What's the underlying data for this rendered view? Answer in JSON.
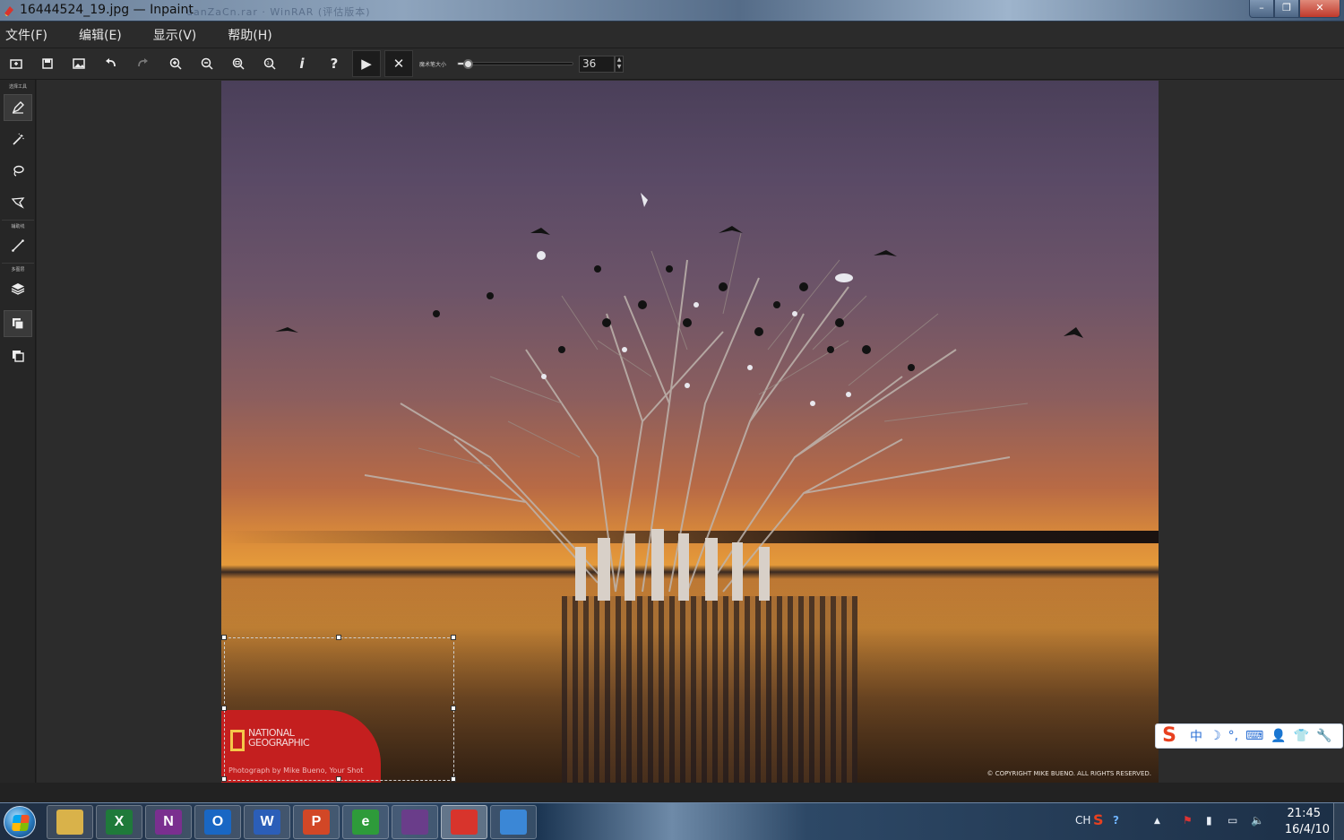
{
  "window": {
    "title": "16444524_19.jpg — Inpaint",
    "background_ghost_text": "uanZaCn.rar · WinRAR (评估版本)"
  },
  "window_controls": {
    "minimize": "–",
    "maximize": "❐",
    "close": "✕"
  },
  "menu": [
    "文件(F)",
    "编辑(E)",
    "显示(V)",
    "帮助(H)"
  ],
  "toolbar": {
    "buttons": [
      {
        "name": "open-icon"
      },
      {
        "name": "save-icon"
      },
      {
        "name": "image-icon"
      },
      {
        "name": "undo-icon"
      },
      {
        "name": "redo-icon"
      },
      {
        "name": "zoom-in-icon"
      },
      {
        "name": "zoom-out-icon"
      },
      {
        "name": "zoom-fit-icon"
      },
      {
        "name": "zoom-actual-icon"
      },
      {
        "name": "info-icon",
        "glyph": "i"
      },
      {
        "name": "help-icon",
        "glyph": "?"
      },
      {
        "name": "run-icon",
        "glyph": "▶"
      },
      {
        "name": "cancel-icon",
        "glyph": "✕"
      }
    ],
    "brush_size_label": "魔术笔大小",
    "brush_size_value": "36",
    "brush_size_fraction": 0.08
  },
  "tool_panel": {
    "sections": [
      "选择工具",
      "辅助线",
      "多图层"
    ],
    "tools": [
      {
        "name": "marker-tool-icon",
        "active": true
      },
      {
        "name": "magic-wand-tool-icon",
        "active": false
      },
      {
        "name": "lasso-tool-icon",
        "active": false
      },
      {
        "name": "polygon-lasso-tool-icon",
        "active": false
      },
      {
        "name": "guide-line-tool-icon",
        "active": false
      },
      {
        "name": "layers-tool-icon",
        "active": false
      },
      {
        "name": "multi-view-icon",
        "active": true
      },
      {
        "name": "single-view-icon",
        "active": false
      }
    ]
  },
  "image": {
    "badge_title_line1": "NATIONAL",
    "badge_title_line2": "GEOGRAPHIC",
    "badge_credit": "Photograph by Mike Bueno, Your Shot",
    "copyright": "© COPYRIGHT MIKE BUENO. ALL RIGHTS RESERVED."
  },
  "ime": {
    "logo": "S",
    "items": [
      "中",
      "☽",
      "°,",
      "⌨",
      "👤",
      "👕",
      "🔧"
    ]
  },
  "taskbar": {
    "apps": [
      {
        "name": "file-explorer-icon",
        "label": "",
        "color": "#d9b24a"
      },
      {
        "name": "excel-icon",
        "label": "X",
        "color": "#1f7a3a"
      },
      {
        "name": "onenote-icon",
        "label": "N",
        "color": "#7a2f8f"
      },
      {
        "name": "outlook-icon",
        "label": "O",
        "color": "#1967c4"
      },
      {
        "name": "word-icon",
        "label": "W",
        "color": "#2b5eb8"
      },
      {
        "name": "powerpoint-icon",
        "label": "P",
        "color": "#d24726"
      },
      {
        "name": "browser-icon",
        "label": "e",
        "color": "#2e9b3a"
      },
      {
        "name": "winrar-icon",
        "label": "",
        "color": "#6a3d8a"
      },
      {
        "name": "inpaint-icon",
        "label": "",
        "color": "#d8342c"
      },
      {
        "name": "game-icon",
        "label": "",
        "color": "#3b87d6"
      }
    ],
    "tray": {
      "lang": "CH",
      "time": "21:45",
      "date": "16/4/10"
    }
  }
}
